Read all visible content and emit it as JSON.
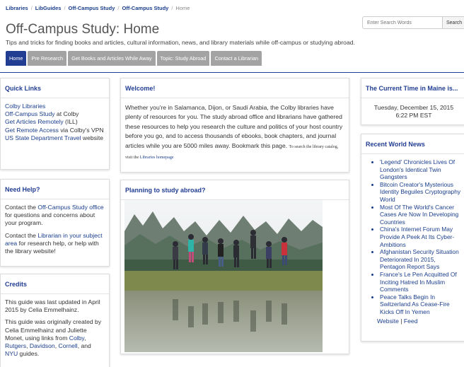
{
  "breadcrumb": [
    {
      "label": "Libraries"
    },
    {
      "label": "LibGuides"
    },
    {
      "label": "Off-Campus Study"
    },
    {
      "label": "Off-Campus Study"
    }
  ],
  "breadcrumb_current": "Home",
  "search": {
    "placeholder": "Enter Search Words",
    "button_label": "Search"
  },
  "page": {
    "title": "Off-Campus Study: Home",
    "description": "Tips and tricks for finding books and articles, cultural information, news, and library materials while off-campus or studying abroad."
  },
  "tabs": [
    {
      "label": "Home",
      "active": true
    },
    {
      "label": "Pre Research",
      "active": false
    },
    {
      "label": "Get Books and Articles While Away",
      "active": false
    },
    {
      "label": "Topic: Study Abroad",
      "active": false
    },
    {
      "label": "Contact a Librarian",
      "active": false
    }
  ],
  "quick_links": {
    "title": "Quick Links",
    "items": [
      {
        "link": "Colby Libraries",
        "text": ""
      },
      {
        "link": "Off-Campus Study",
        "text": " at Colby"
      },
      {
        "link": "Get Articles Remotely",
        "text": " (ILL)"
      },
      {
        "link": "Get Remote Access",
        "text": " via Colby's VPN"
      },
      {
        "link": "US State Department Travel",
        "text": " website"
      }
    ]
  },
  "need_help": {
    "title": "Need Help?",
    "p1_before": "Contact the ",
    "p1_link": "Off-Campus Study office",
    "p1_after": " for questions and concerns about your program.",
    "p2_before": "Contact the ",
    "p2_link": "Librarian in your subject area",
    "p2_after": " for research help, or help with the library website!"
  },
  "credits": {
    "title": "Credits",
    "p1": "This guide was last updated in April 2015 by Celia Emmelhainz.",
    "p2_before": "This guide was originally created by Celia Emmelhainz and Juliette Monet, using links from ",
    "link1": "Colby",
    "comma1": ",",
    "link2": "Rutgers",
    "comma2": ",",
    "link3": "Davidson",
    "comma3": ",",
    "link4": "Cornell",
    "and_text": ", and",
    "link5": "NYU",
    "p2_after": " guides."
  },
  "welcome": {
    "title": "Welcome!",
    "body": "Whether you're in Salamanca, Dijon, or Saudi Arabia, the Colby libraries have plenty of resources for you. The study abroad office and librarians have gathered these resources to help you research the culture and politics of your host country before you go, and to access thousands of ebooks, book chapters, and journal articles while you are 5000 miles away. Bookmark this page.",
    "small_text": "To search the library catalog, visit the ",
    "small_link": "Libraries homepage"
  },
  "planning": {
    "title": "Planning to study abroad?"
  },
  "current_time": {
    "title": "The Current Time in Maine is...",
    "date": "Tuesday, December 15, 2015",
    "time": "6:22 PM EST"
  },
  "world_news": {
    "title": "Recent World News",
    "items": [
      "'Legend' Chronicles Lives Of London's Identical Twin Gangsters",
      "Bitcoin Creator's Mysterious Identity Beguiles Cryptography World",
      "Most Of The World's Cancer Cases Are Now In Developing Countries",
      "China's Internet Forum May Provide A Peek At Its Cyber-Ambitions",
      "Afghanistan Security Situation Deteriorated In 2015, Pentagon Report Says",
      "France's Le Pen Acquitted Of Inciting Hatred In Muslim Comments",
      "Peace Talks Begin In Switzerland As Cease-Fire Kicks Off In Yemen"
    ],
    "website_label": "Website",
    "divider": " | ",
    "feed_label": "Feed"
  },
  "colors": {
    "accent": "#223e93",
    "tab_inactive": "#a3a3a3",
    "link": "#1a3e8c"
  }
}
